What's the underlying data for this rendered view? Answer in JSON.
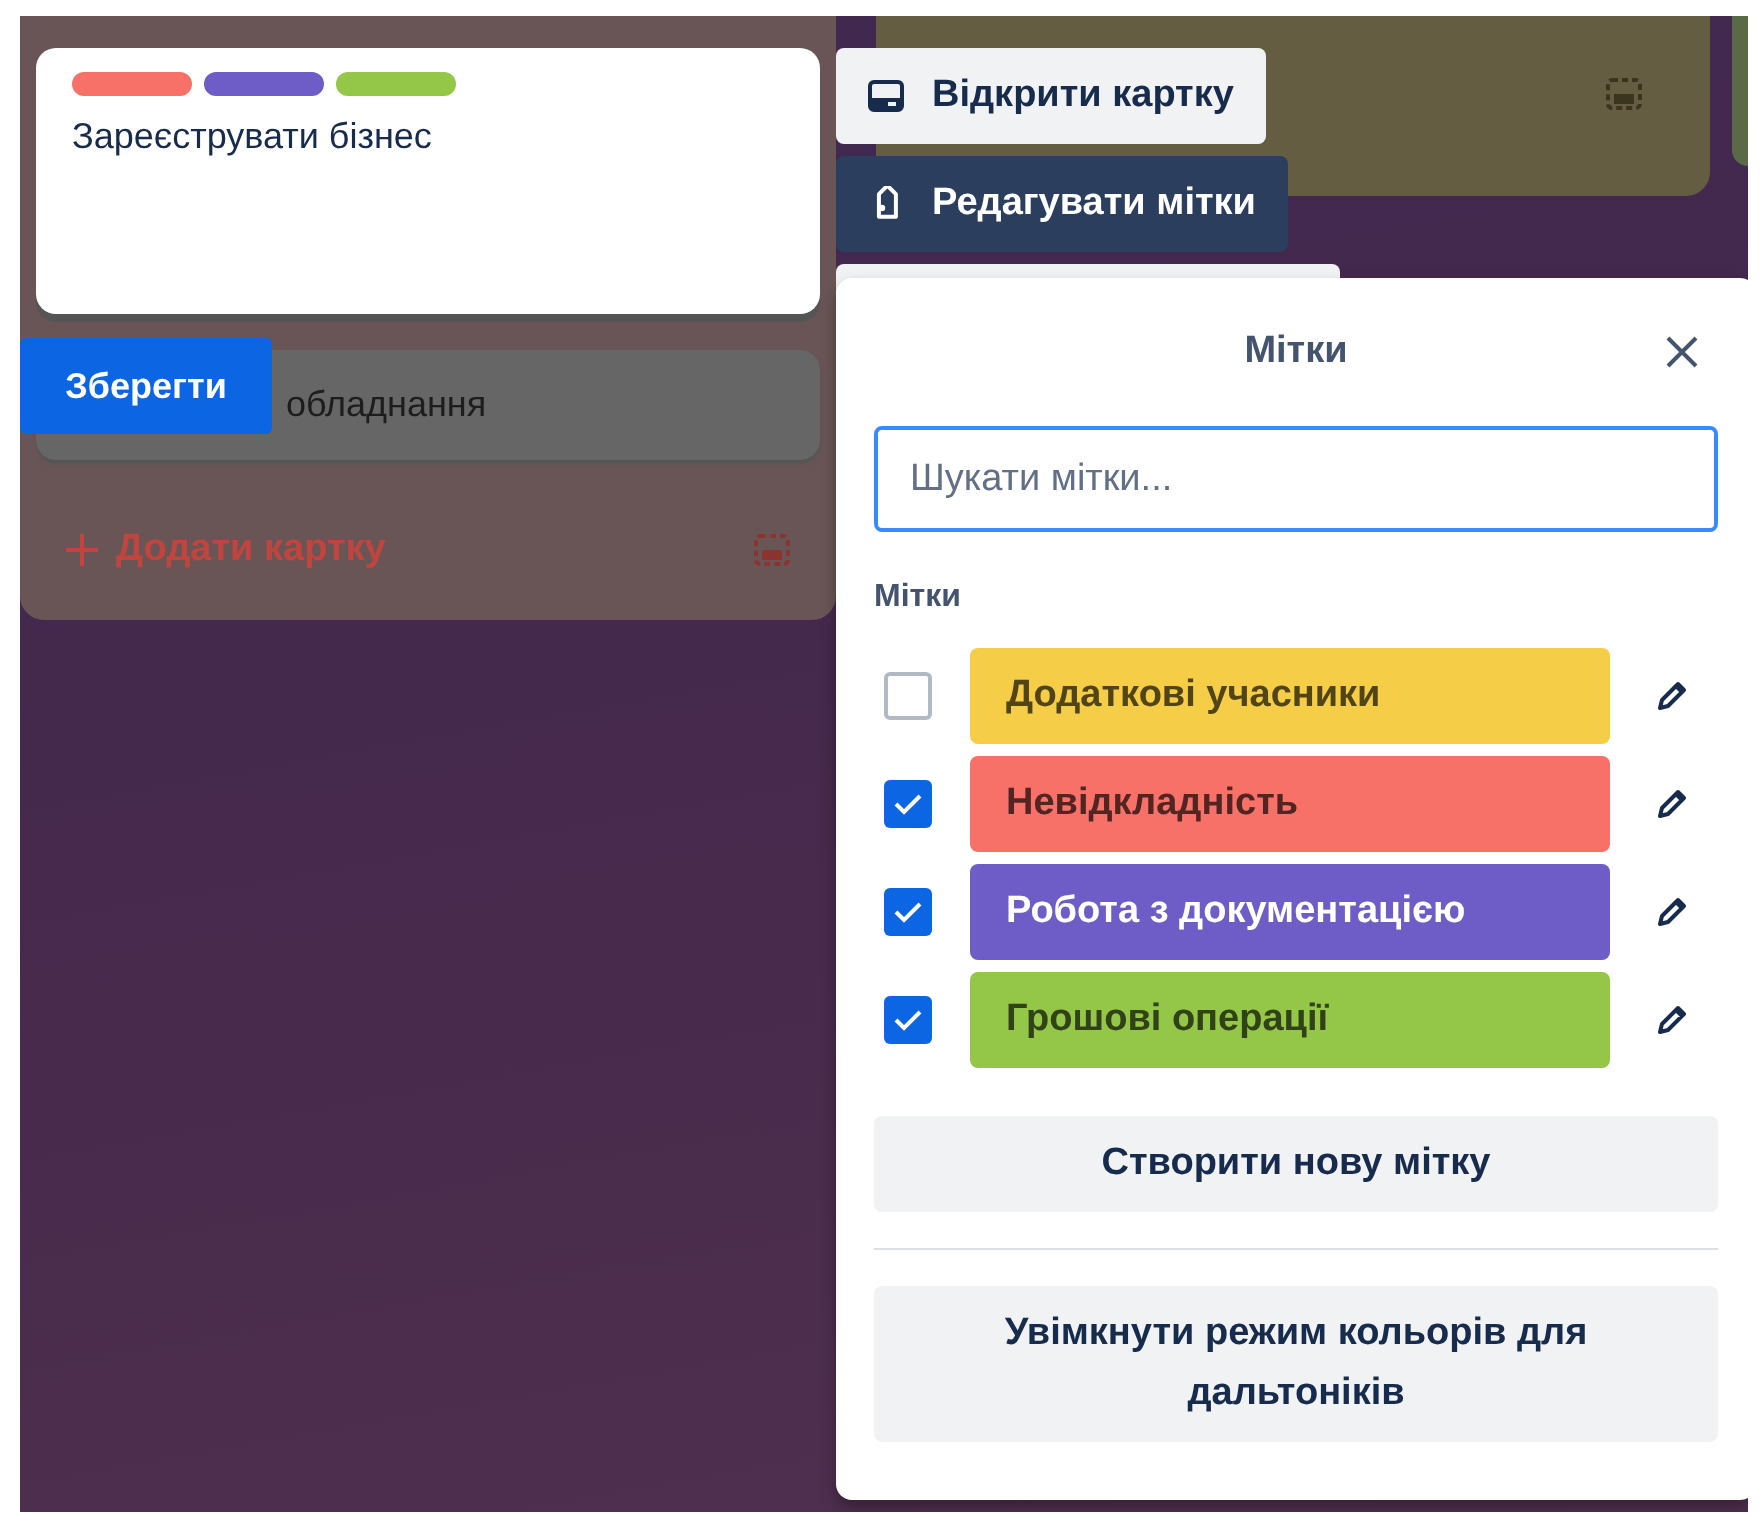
{
  "lists": [
    {
      "cards": [
        {
          "kind": "editing",
          "labels": [
            {
              "color": "#f87168"
            },
            {
              "color": "#6e5dc6"
            },
            {
              "color": "#94c748"
            }
          ],
          "title": "Зареєструвати бізнес"
        },
        {
          "kind": "card",
          "title": "обладнання"
        }
      ],
      "save_button": "Зберегти",
      "add_card": "Додати картку"
    },
    {
      "kind": "olive"
    },
    {
      "kind": "green"
    }
  ],
  "card_actions": [
    {
      "label": "Відкрити картку",
      "kind": "open"
    },
    {
      "label": "Редагувати мітки",
      "kind": "labels",
      "selected": true
    },
    {
      "kind": "hidden"
    }
  ],
  "popover": {
    "title": "Мітки",
    "search": {
      "placeholder": "Шукати мітки..."
    },
    "section": "Мітки",
    "labels": [
      {
        "name": "Додаткові учасники",
        "color": "#f5cd47",
        "checked": false
      },
      {
        "name": "Невідкладність",
        "color": "#f87168",
        "checked": true
      },
      {
        "name": "Робота з документацією",
        "color": "#6e5dc6",
        "checked": true
      },
      {
        "name": "Грошові операції",
        "color": "#94c748",
        "checked": true
      }
    ],
    "create_button": "Створити нову мітку",
    "colorblind_button": "Увімкнути режим кольорів для дальтоніків"
  }
}
